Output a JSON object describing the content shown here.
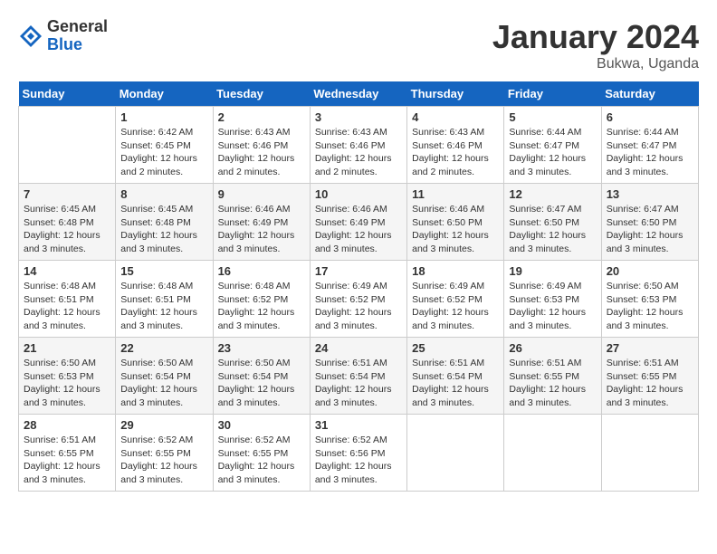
{
  "logo": {
    "general": "General",
    "blue": "Blue"
  },
  "title": "January 2024",
  "subtitle": "Bukwa, Uganda",
  "headers": [
    "Sunday",
    "Monday",
    "Tuesday",
    "Wednesday",
    "Thursday",
    "Friday",
    "Saturday"
  ],
  "weeks": [
    [
      {
        "day": "",
        "sunrise": "",
        "sunset": "",
        "daylight": ""
      },
      {
        "day": "1",
        "sunrise": "Sunrise: 6:42 AM",
        "sunset": "Sunset: 6:45 PM",
        "daylight": "Daylight: 12 hours and 2 minutes."
      },
      {
        "day": "2",
        "sunrise": "Sunrise: 6:43 AM",
        "sunset": "Sunset: 6:46 PM",
        "daylight": "Daylight: 12 hours and 2 minutes."
      },
      {
        "day": "3",
        "sunrise": "Sunrise: 6:43 AM",
        "sunset": "Sunset: 6:46 PM",
        "daylight": "Daylight: 12 hours and 2 minutes."
      },
      {
        "day": "4",
        "sunrise": "Sunrise: 6:43 AM",
        "sunset": "Sunset: 6:46 PM",
        "daylight": "Daylight: 12 hours and 2 minutes."
      },
      {
        "day": "5",
        "sunrise": "Sunrise: 6:44 AM",
        "sunset": "Sunset: 6:47 PM",
        "daylight": "Daylight: 12 hours and 3 minutes."
      },
      {
        "day": "6",
        "sunrise": "Sunrise: 6:44 AM",
        "sunset": "Sunset: 6:47 PM",
        "daylight": "Daylight: 12 hours and 3 minutes."
      }
    ],
    [
      {
        "day": "7",
        "sunrise": "Sunrise: 6:45 AM",
        "sunset": "Sunset: 6:48 PM",
        "daylight": "Daylight: 12 hours and 3 minutes."
      },
      {
        "day": "8",
        "sunrise": "Sunrise: 6:45 AM",
        "sunset": "Sunset: 6:48 PM",
        "daylight": "Daylight: 12 hours and 3 minutes."
      },
      {
        "day": "9",
        "sunrise": "Sunrise: 6:46 AM",
        "sunset": "Sunset: 6:49 PM",
        "daylight": "Daylight: 12 hours and 3 minutes."
      },
      {
        "day": "10",
        "sunrise": "Sunrise: 6:46 AM",
        "sunset": "Sunset: 6:49 PM",
        "daylight": "Daylight: 12 hours and 3 minutes."
      },
      {
        "day": "11",
        "sunrise": "Sunrise: 6:46 AM",
        "sunset": "Sunset: 6:50 PM",
        "daylight": "Daylight: 12 hours and 3 minutes."
      },
      {
        "day": "12",
        "sunrise": "Sunrise: 6:47 AM",
        "sunset": "Sunset: 6:50 PM",
        "daylight": "Daylight: 12 hours and 3 minutes."
      },
      {
        "day": "13",
        "sunrise": "Sunrise: 6:47 AM",
        "sunset": "Sunset: 6:50 PM",
        "daylight": "Daylight: 12 hours and 3 minutes."
      }
    ],
    [
      {
        "day": "14",
        "sunrise": "Sunrise: 6:48 AM",
        "sunset": "Sunset: 6:51 PM",
        "daylight": "Daylight: 12 hours and 3 minutes."
      },
      {
        "day": "15",
        "sunrise": "Sunrise: 6:48 AM",
        "sunset": "Sunset: 6:51 PM",
        "daylight": "Daylight: 12 hours and 3 minutes."
      },
      {
        "day": "16",
        "sunrise": "Sunrise: 6:48 AM",
        "sunset": "Sunset: 6:52 PM",
        "daylight": "Daylight: 12 hours and 3 minutes."
      },
      {
        "day": "17",
        "sunrise": "Sunrise: 6:49 AM",
        "sunset": "Sunset: 6:52 PM",
        "daylight": "Daylight: 12 hours and 3 minutes."
      },
      {
        "day": "18",
        "sunrise": "Sunrise: 6:49 AM",
        "sunset": "Sunset: 6:52 PM",
        "daylight": "Daylight: 12 hours and 3 minutes."
      },
      {
        "day": "19",
        "sunrise": "Sunrise: 6:49 AM",
        "sunset": "Sunset: 6:53 PM",
        "daylight": "Daylight: 12 hours and 3 minutes."
      },
      {
        "day": "20",
        "sunrise": "Sunrise: 6:50 AM",
        "sunset": "Sunset: 6:53 PM",
        "daylight": "Daylight: 12 hours and 3 minutes."
      }
    ],
    [
      {
        "day": "21",
        "sunrise": "Sunrise: 6:50 AM",
        "sunset": "Sunset: 6:53 PM",
        "daylight": "Daylight: 12 hours and 3 minutes."
      },
      {
        "day": "22",
        "sunrise": "Sunrise: 6:50 AM",
        "sunset": "Sunset: 6:54 PM",
        "daylight": "Daylight: 12 hours and 3 minutes."
      },
      {
        "day": "23",
        "sunrise": "Sunrise: 6:50 AM",
        "sunset": "Sunset: 6:54 PM",
        "daylight": "Daylight: 12 hours and 3 minutes."
      },
      {
        "day": "24",
        "sunrise": "Sunrise: 6:51 AM",
        "sunset": "Sunset: 6:54 PM",
        "daylight": "Daylight: 12 hours and 3 minutes."
      },
      {
        "day": "25",
        "sunrise": "Sunrise: 6:51 AM",
        "sunset": "Sunset: 6:54 PM",
        "daylight": "Daylight: 12 hours and 3 minutes."
      },
      {
        "day": "26",
        "sunrise": "Sunrise: 6:51 AM",
        "sunset": "Sunset: 6:55 PM",
        "daylight": "Daylight: 12 hours and 3 minutes."
      },
      {
        "day": "27",
        "sunrise": "Sunrise: 6:51 AM",
        "sunset": "Sunset: 6:55 PM",
        "daylight": "Daylight: 12 hours and 3 minutes."
      }
    ],
    [
      {
        "day": "28",
        "sunrise": "Sunrise: 6:51 AM",
        "sunset": "Sunset: 6:55 PM",
        "daylight": "Daylight: 12 hours and 3 minutes."
      },
      {
        "day": "29",
        "sunrise": "Sunrise: 6:52 AM",
        "sunset": "Sunset: 6:55 PM",
        "daylight": "Daylight: 12 hours and 3 minutes."
      },
      {
        "day": "30",
        "sunrise": "Sunrise: 6:52 AM",
        "sunset": "Sunset: 6:55 PM",
        "daylight": "Daylight: 12 hours and 3 minutes."
      },
      {
        "day": "31",
        "sunrise": "Sunrise: 6:52 AM",
        "sunset": "Sunset: 6:56 PM",
        "daylight": "Daylight: 12 hours and 3 minutes."
      },
      {
        "day": "",
        "sunrise": "",
        "sunset": "",
        "daylight": ""
      },
      {
        "day": "",
        "sunrise": "",
        "sunset": "",
        "daylight": ""
      },
      {
        "day": "",
        "sunrise": "",
        "sunset": "",
        "daylight": ""
      }
    ]
  ]
}
